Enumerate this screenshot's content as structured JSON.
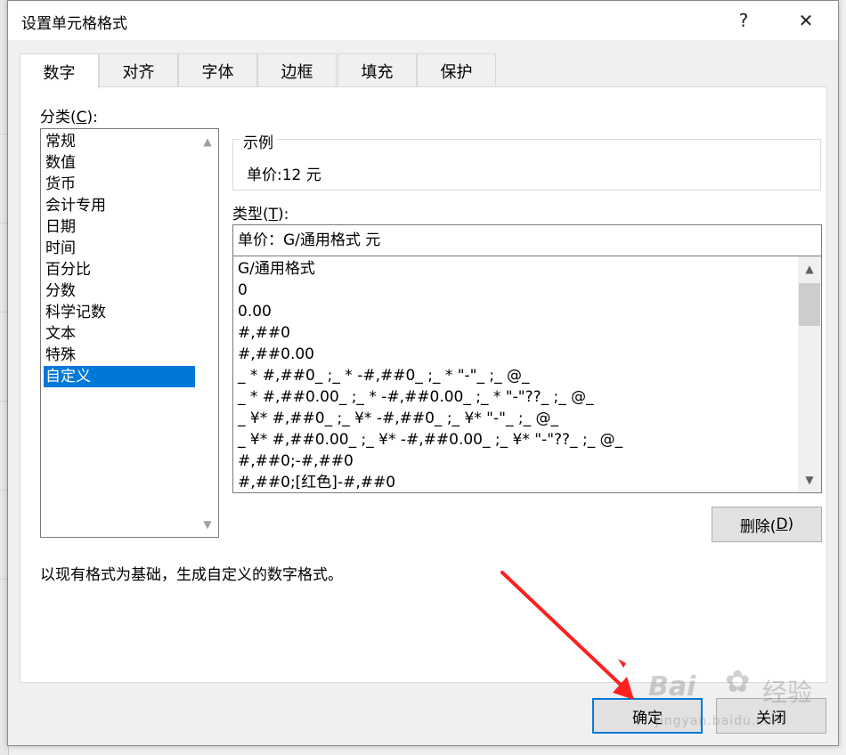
{
  "dialog": {
    "title": "设置单元格格式",
    "help_glyph": "?",
    "close_glyph": "✕"
  },
  "tabs": [
    {
      "label": "数字",
      "active": true
    },
    {
      "label": "对齐"
    },
    {
      "label": "字体"
    },
    {
      "label": "边框"
    },
    {
      "label": "填充"
    },
    {
      "label": "保护"
    }
  ],
  "category": {
    "label_prefix": "分类(",
    "label_key": "C",
    "label_suffix": "):",
    "items": [
      "常规",
      "数值",
      "货币",
      "会计专用",
      "日期",
      "时间",
      "百分比",
      "分数",
      "科学记数",
      "文本",
      "特殊",
      "自定义"
    ],
    "selected": "自定义"
  },
  "sample": {
    "legend": "示例",
    "value": "单价:12 元"
  },
  "type": {
    "label_prefix": "类型(",
    "label_key": "T",
    "label_suffix": "):",
    "input_value": "单价：G/通用格式 元",
    "formats": [
      "G/通用格式",
      "0",
      "0.00",
      "#,##0",
      "#,##0.00",
      "_ * #,##0_ ;_ * -#,##0_ ;_ * \"-\"_ ;_ @_",
      "_ * #,##0.00_ ;_ * -#,##0.00_ ;_ * \"-\"??_ ;_ @_",
      "_ ¥* #,##0_ ;_ ¥* -#,##0_ ;_ ¥* \"-\"_ ;_ @_",
      "_ ¥* #,##0.00_ ;_ ¥* -#,##0.00_ ;_ ¥* \"-\"??_ ;_ @_",
      "#,##0;-#,##0",
      "#,##0;[红色]-#,##0"
    ]
  },
  "buttons": {
    "delete_prefix": "删除(",
    "delete_key": "D",
    "delete_suffix": ")",
    "ok": "确定",
    "close": "关闭"
  },
  "description": "以现有格式为基础，生成自定义的数字格式。",
  "watermark": {
    "brand": "Bai",
    "brand_cn": "经验",
    "url": "jingyan.baidu.com"
  },
  "colors": {
    "selection": "#0078d7",
    "annotation_arrow": "#ff2020"
  }
}
